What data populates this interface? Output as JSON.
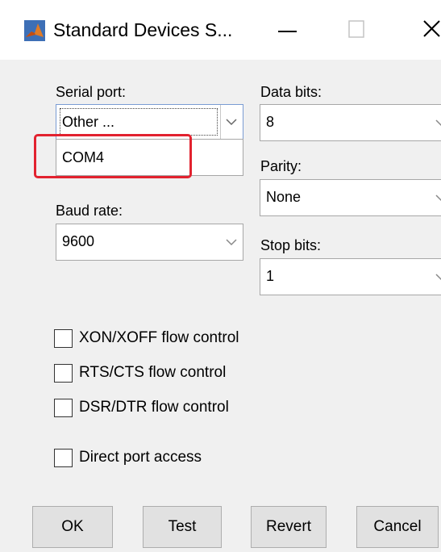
{
  "window": {
    "title": "Standard Devices S...",
    "app_icon": "matlab-icon",
    "controls": [
      "minimize-icon",
      "maximize-icon",
      "close-icon"
    ]
  },
  "serial_port": {
    "label": "Serial port:",
    "selected": "Other ...",
    "dropdown_items": [
      "COM4"
    ]
  },
  "baud_rate": {
    "label": "Baud rate:",
    "selected": "9600"
  },
  "data_bits": {
    "label": "Data bits:",
    "selected": "8"
  },
  "parity": {
    "label": "Parity:",
    "selected": "None"
  },
  "stop_bits": {
    "label": "Stop bits:",
    "selected": "1"
  },
  "checkboxes": [
    {
      "label": "XON/XOFF flow control",
      "checked": false
    },
    {
      "label": "RTS/CTS flow control",
      "checked": false
    },
    {
      "label": "DSR/DTR flow control",
      "checked": false
    },
    {
      "label": "Direct port access",
      "checked": false
    }
  ],
  "buttons": {
    "ok": "OK",
    "test": "Test",
    "revert": "Revert",
    "cancel": "Cancel"
  },
  "colors": {
    "highlight": "#e2222f",
    "background": "#f0f0f0"
  }
}
